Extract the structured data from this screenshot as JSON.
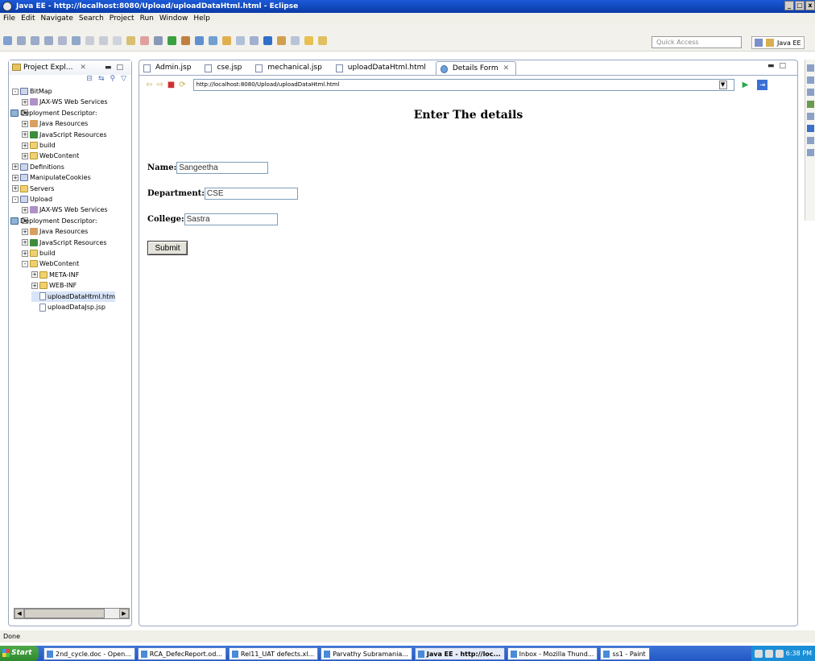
{
  "window": {
    "title": "Java EE - http://localhost:8080/Upload/uploadDataHtml.html - Eclipse",
    "controls": [
      "_",
      "□",
      "x"
    ]
  },
  "menu": [
    "File",
    "Edit",
    "Navigate",
    "Search",
    "Project",
    "Run",
    "Window",
    "Help"
  ],
  "toolbar": {
    "quick_access_placeholder": "Quick Access",
    "perspective_label": "Java EE"
  },
  "explorer": {
    "title": "Project Expl...",
    "tree": [
      {
        "label": "BitMap",
        "depth": 0,
        "icon": "proj",
        "exp": "-"
      },
      {
        "label": "JAX-WS Web Services",
        "depth": 1,
        "icon": "ws",
        "exp": "+"
      },
      {
        "label": "Deployment Descriptor:",
        "depth": 1,
        "icon": "dd",
        "exp": "+"
      },
      {
        "label": "Java Resources",
        "depth": 1,
        "icon": "jr",
        "exp": "+"
      },
      {
        "label": "JavaScript Resources",
        "depth": 1,
        "icon": "js",
        "exp": "+"
      },
      {
        "label": "build",
        "depth": 1,
        "icon": "folder",
        "exp": "+"
      },
      {
        "label": "WebContent",
        "depth": 1,
        "icon": "folder",
        "exp": "+"
      },
      {
        "label": "Definitions",
        "depth": 0,
        "icon": "proj",
        "exp": "+"
      },
      {
        "label": "ManipulateCookies",
        "depth": 0,
        "icon": "proj",
        "exp": "+"
      },
      {
        "label": "Servers",
        "depth": 0,
        "icon": "folder",
        "exp": "+"
      },
      {
        "label": "Upload",
        "depth": 0,
        "icon": "proj",
        "exp": "-"
      },
      {
        "label": "JAX-WS Web Services",
        "depth": 1,
        "icon": "ws",
        "exp": "+"
      },
      {
        "label": "Deployment Descriptor:",
        "depth": 1,
        "icon": "dd",
        "exp": "+"
      },
      {
        "label": "Java Resources",
        "depth": 1,
        "icon": "jr",
        "exp": "+"
      },
      {
        "label": "JavaScript Resources",
        "depth": 1,
        "icon": "js",
        "exp": "+"
      },
      {
        "label": "build",
        "depth": 1,
        "icon": "folder",
        "exp": "+"
      },
      {
        "label": "WebContent",
        "depth": 1,
        "icon": "folder",
        "exp": "-"
      },
      {
        "label": "META-INF",
        "depth": 2,
        "icon": "folder",
        "exp": "+"
      },
      {
        "label": "WEB-INF",
        "depth": 2,
        "icon": "folder",
        "exp": "+"
      },
      {
        "label": "uploadDataHtml.htm",
        "depth": 2,
        "icon": "file",
        "exp": "",
        "selected": true
      },
      {
        "label": "uploadDataJsp.jsp",
        "depth": 2,
        "icon": "file",
        "exp": ""
      }
    ]
  },
  "editor": {
    "tabs": [
      {
        "label": "Admin.jsp",
        "active": false
      },
      {
        "label": "cse.jsp",
        "active": false
      },
      {
        "label": "mechanical.jsp",
        "active": false
      },
      {
        "label": "uploadDataHtml.html",
        "active": false
      },
      {
        "label": "Details Form",
        "active": true
      }
    ],
    "url": "http://localhost:8080/Upload/uploadDataHtml.html"
  },
  "form": {
    "title": "Enter The details",
    "name_label": "Name:",
    "name_value": "Sangeetha",
    "department_label": "Department:",
    "department_value": "CSE",
    "college_label": "College:",
    "college_value": "Sastra",
    "submit_label": "Submit"
  },
  "status": "Done",
  "taskbar": {
    "start_label": "Start",
    "tasks": [
      {
        "label": "2nd_cycle.doc - Open...",
        "active": false
      },
      {
        "label": "RCA_DefecReport.od...",
        "active": false
      },
      {
        "label": "Rel11_UAT defects.xl...",
        "active": false
      },
      {
        "label": "Parvathy Subramania...",
        "active": false
      },
      {
        "label": "Java EE - http://loc...",
        "active": true
      },
      {
        "label": "Inbox - Mozilla Thund...",
        "active": false
      },
      {
        "label": "ss1 - Paint",
        "active": false
      }
    ],
    "clock": "6:38 PM"
  }
}
